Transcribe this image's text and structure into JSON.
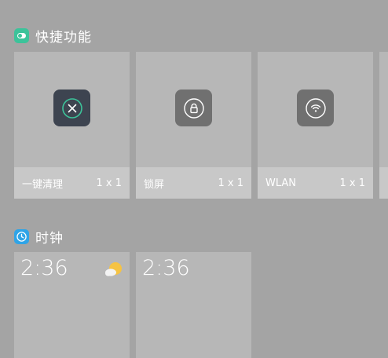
{
  "sections": {
    "shortcuts": {
      "title": "快捷功能",
      "icon": "toggle-app-icon"
    },
    "clock": {
      "title": "时钟",
      "icon": "clock-app-icon"
    }
  },
  "widgets": [
    {
      "label": "一键清理",
      "size": "1 x 1",
      "icon": "close-circle-icon",
      "tile_color": "#3d4450",
      "accent": "#3cc39a"
    },
    {
      "label": "锁屏",
      "size": "1 x 1",
      "icon": "lock-icon",
      "tile_color": "#707070"
    },
    {
      "label": "WLAN",
      "size": "1 x 1",
      "icon": "wifi-icon",
      "tile_color": "#707070"
    }
  ],
  "clock_widgets": [
    {
      "time": "2:36",
      "weather_icon": "sun-cloud-icon"
    },
    {
      "time": "2:36"
    }
  ],
  "colors": {
    "background": "#a4a4a4",
    "card": "#b7b7b7",
    "card_footer": "#c8c8c8",
    "toggle_app": "#3cc39a",
    "clock_app": "#2fa4e7",
    "sun": "#f6c343"
  }
}
